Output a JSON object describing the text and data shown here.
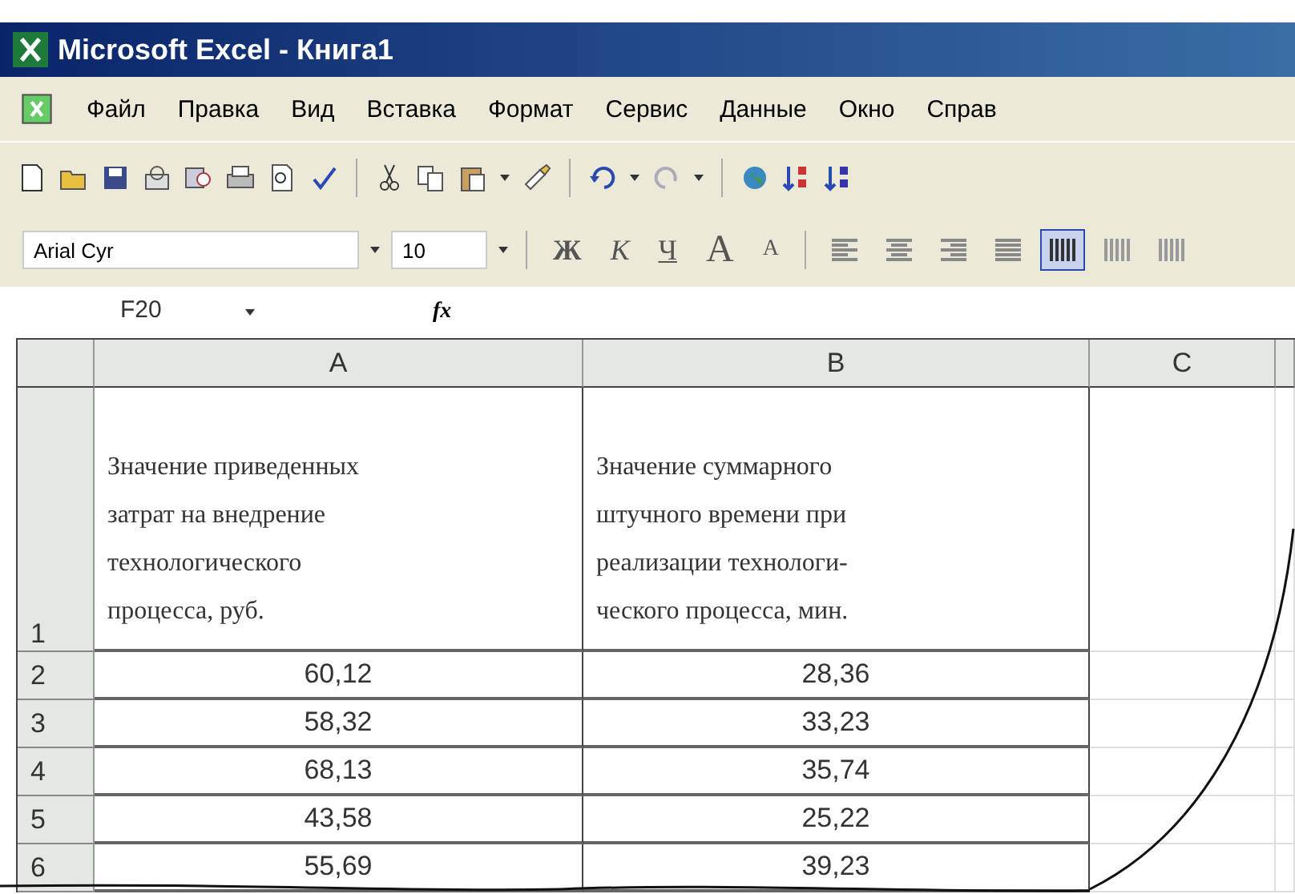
{
  "window": {
    "title": "Microsoft Excel - Книга1"
  },
  "menu": [
    "Файл",
    "Правка",
    "Вид",
    "Вставка",
    "Формат",
    "Сервис",
    "Данные",
    "Окно",
    "Справ"
  ],
  "formatting": {
    "font": "Arial Cyr",
    "size": "10",
    "style_buttons": [
      {
        "label": "Ж",
        "kind": "bold"
      },
      {
        "label": "К",
        "kind": "italic"
      },
      {
        "label": "Ч",
        "kind": "underline"
      },
      {
        "label": "A",
        "kind": "grow"
      },
      {
        "label": "A",
        "kind": "shrink"
      }
    ],
    "align_buttons": [
      {
        "selected": false
      },
      {
        "selected": false
      },
      {
        "selected": false
      },
      {
        "selected": false
      },
      {
        "selected": true
      },
      {
        "selected": false
      },
      {
        "selected": false
      }
    ]
  },
  "formula_bar": {
    "name_box": "F20",
    "function_label": "fx"
  },
  "columns": [
    "A",
    "B",
    "C"
  ],
  "rows": [
    {
      "number": "1",
      "cells": [
        "Значение приведенных\nзатрат на внедрение\nтехнологического\nпроцесса, руб.",
        "Значение суммарного\nштучного времени при\nреализации технологи-\nческого процесса, мин."
      ]
    },
    {
      "number": "2",
      "cells": [
        "60,12",
        "28,36"
      ]
    },
    {
      "number": "3",
      "cells": [
        "58,32",
        "33,23"
      ]
    },
    {
      "number": "4",
      "cells": [
        "68,13",
        "35,74"
      ]
    },
    {
      "number": "5",
      "cells": [
        "43,58",
        "25,22"
      ]
    },
    {
      "number": "6",
      "cells": [
        "55,69",
        "39,23"
      ]
    }
  ]
}
